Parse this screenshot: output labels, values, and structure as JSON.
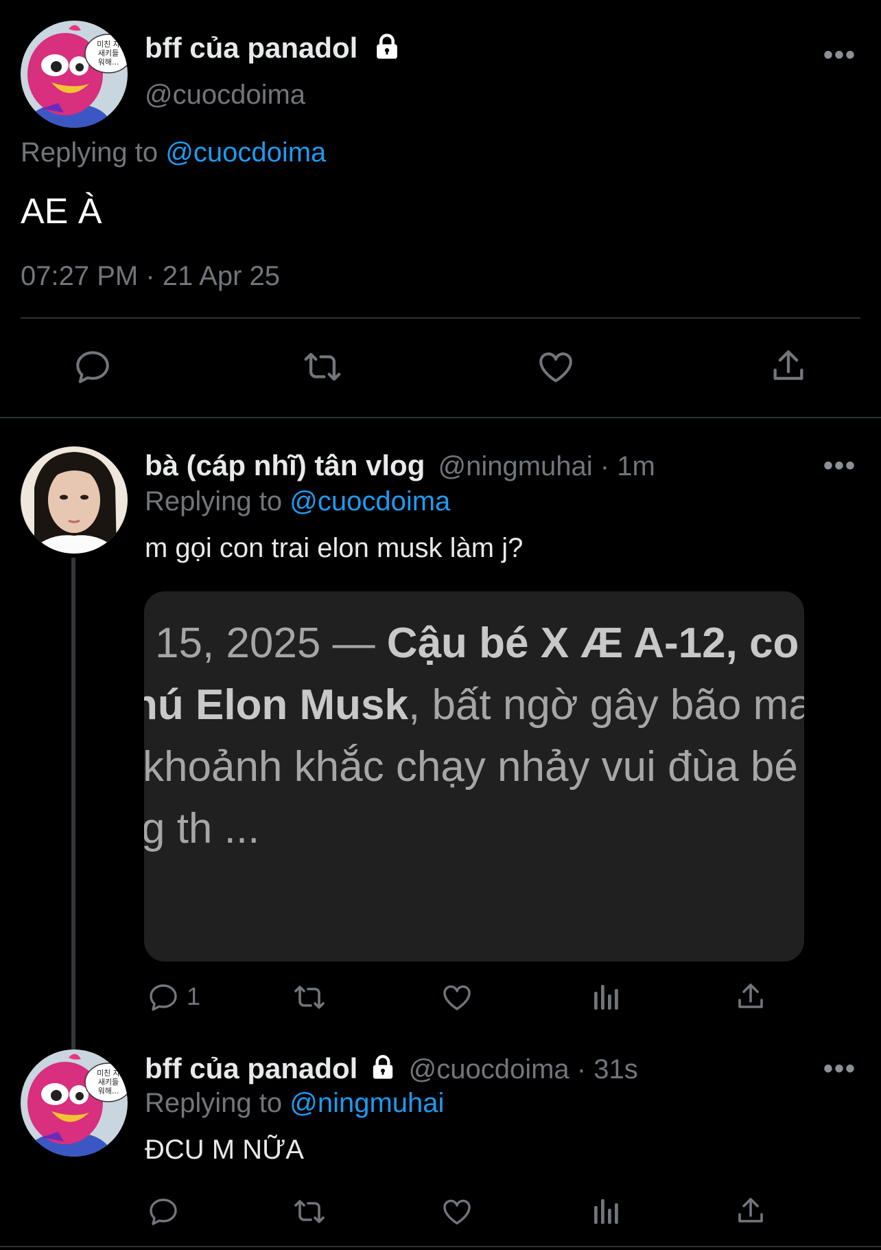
{
  "main_tweet": {
    "display_name": "bff của panadol",
    "handle": "@cuocdoima",
    "replying_prefix": "Replying to ",
    "replying_to": "@cuocdoima",
    "text": "AE À",
    "timestamp": "07:27 PM · 21 Apr 25",
    "avatar_bubble": "미친 자\n새키들\n워해..."
  },
  "reply1": {
    "display_name": "bà (cáp nhĩ) tân vlog",
    "meta": "@ningmuhai · 1m",
    "replying_prefix": "Replying to ",
    "replying_to": "@cuocdoima",
    "text": "m gọi con trai elon musk làm j?",
    "reply_count": "1",
    "card": {
      "line1_plain": " 15, 2025 — ",
      "line1_bold": "Cậu bé X Æ A-12, co",
      "line2_bold": "hú Elon Musk",
      "line2_plain": ", bất ngờ gây bão ma",
      "line3": "khoảnh khắc chạy nhảy vui đùa bé",
      "line4": "g th ..."
    }
  },
  "reply2": {
    "display_name": "bff của panadol",
    "meta": "@cuocdoima · 31s",
    "replying_prefix": "Replying to ",
    "replying_to": "@ningmuhai",
    "text": "ĐCU M NỮA"
  },
  "icons": [
    "reply-icon",
    "retweet-icon",
    "like-icon",
    "share-icon",
    "views-icon",
    "lock-icon",
    "more-icon"
  ],
  "colors": {
    "background": "#000000",
    "text": "#e7e9ea",
    "secondary": "#71767b",
    "link": "#1d9bf0",
    "divider": "#2f3336",
    "card": "#202020"
  }
}
